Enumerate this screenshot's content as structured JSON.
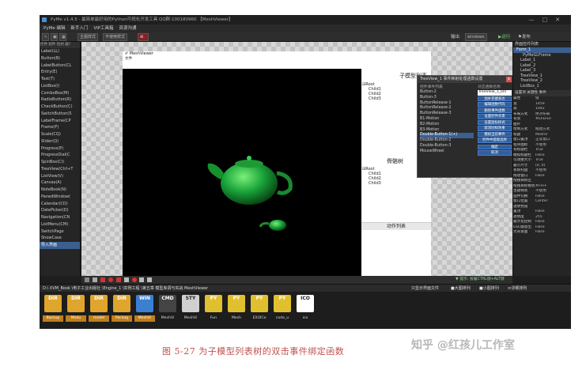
{
  "app": {
    "title": "PyMe v1.4.5 - 最简单最好用的Python可视化开发工具 QQ群:100180960 【MeshViewer】"
  },
  "menu": [
    "PyMe 编辑",
    "新手入门",
    "VIP工具箱",
    "资源沟通"
  ],
  "toolbar": {
    "btn1": "主题样式",
    "btn2": "不使用样式",
    "output": "输出",
    "platform": "windows",
    "run": "▶运行",
    "publish": "⚑发布"
  },
  "left_panel": {
    "tabs": "控件 组件 粒材 器?",
    "items": [
      "Label(LL)",
      "Button(B)",
      "LabelButton(CL",
      "Entry(E)",
      "Text(T)",
      "ListBox(I)",
      "ComboBox(M)",
      "RadioButton(R)",
      "CheckButton(C)",
      "SwitchButton(S",
      "LabelFrame(CP",
      "Frame(F)",
      "Scale(CQ)",
      "Slider(Q)",
      "Progress(P)",
      "ProgressDial(C",
      "SpinBox(CI)",
      "TreeView(Ctrl+T",
      "ListView(V)",
      "Canvas(A)",
      "NoteBook(N)",
      "PanedWindow(",
      "Calendar(CD)",
      "DatePicker(D)",
      "Navigation(CN",
      "ListMenu(CM)",
      "SwitchPage",
      "ShowCase",
      "导入界面"
    ]
  },
  "meshviewer": {
    "title": "MeshViewer",
    "menu": "文件",
    "right": {
      "header1": "子模型列表",
      "tree1": {
        "root": "Root",
        "children": [
          "Child1",
          "Child2",
          "Child3"
        ]
      },
      "header2": "骨骼树",
      "tree2": {
        "root": "Root",
        "children": [
          "Child1",
          "Child2",
          "Child3"
        ]
      },
      "header3": "动作列表"
    }
  },
  "dialog": {
    "title": "TreeView_1 事件映射处理函数设置",
    "close": "x",
    "col1_header": "控件事件列表",
    "col2_header": "对应函数名称",
    "events": [
      "Button-2",
      "Button-3",
      "ButtonRelease-1",
      "ButtonRelease-2",
      "ButtonRelease-3",
      "B1-Motion",
      "B2-Motion",
      "B3-Motion",
      "Double-Button-1(+)",
      "Double-Button-2",
      "Double-Button-3",
      "MouseWheel"
    ],
    "func_input": "TreeView_1_onl",
    "buttons": [
      "加补充键表达",
      "编辑函数代码",
      "删除事件函数",
      "设置控件背景",
      "设置鼠标样式",
      "取消同样效果",
      "模拟当前事件",
      "控件中提取选择"
    ],
    "ok": "确定",
    "cancel": "取消"
  },
  "right_panel": {
    "title": "界面控件列表",
    "tree": [
      {
        "label": "Form_1",
        "sel": true
      },
      {
        "label": "PyMeGLFrame",
        "sel": false
      },
      {
        "label": "Label_1",
        "sel": false
      },
      {
        "label": "Label_2",
        "sel": false
      },
      {
        "label": "Label_3",
        "sel": false
      },
      {
        "label": "TreeView_1",
        "sel": false
      },
      {
        "label": "TreeView_2",
        "sel": false
      },
      {
        "label": "ListBox_1",
        "sel": false
      }
    ],
    "prop_tabs": "设置项 关键性 事件",
    "props": [
      [
        "属性",
        "值"
      ],
      [
        "宽",
        "1459"
      ],
      [
        "高",
        "1042"
      ],
      [
        "布局方式",
        "绝对布局"
      ],
      [
        "背景",
        "#EFEFEF"
      ],
      [
        "图片",
        ""
      ],
      [
        "绘制方式",
        "缩放方式"
      ],
      [
        "标题",
        "MeshV"
      ],
      [
        "窗口置顶",
        "正常窗口"
      ],
      [
        "程序图标",
        "不使用"
      ],
      [
        "有标题栏",
        "True"
      ],
      [
        "模拟标题栏",
        "False"
      ],
      [
        "可调整大小",
        "True"
      ],
      [
        "最小尺寸",
        "(0, 0)"
      ],
      [
        "系统托盘",
        "不使用"
      ],
      [
        "拖动窗口",
        "False"
      ],
      [
        "拖拽目标区",
        ""
      ],
      [
        "拖拽目标模式",
        "#FFFF"
      ],
      [
        "主题样式",
        "不使用"
      ],
      [
        "固件切换",
        "False"
      ],
      [
        "窗口位置",
        "Center"
      ],
      [
        "透明色值",
        ""
      ],
      [
        "置顶",
        "False"
      ],
      [
        "透明度",
        "255"
      ],
      [
        "最大化控制",
        "False"
      ],
      [
        "ESC键退出",
        "False"
      ],
      [
        "大背景图",
        "False"
      ]
    ]
  },
  "status_hint": "▼ 提示: 按着CTRL键+ALT键+B，可对级别进行操作",
  "path": {
    "text": "D:\\ XVM_Book \\电子工业出版社 \\Engine_1 \\实例工程 \\第五章 模型库调与实战 MeshViewer",
    "right1": "只显示界面文件",
    "right2": "■大图排列",
    "right3": "■小图排列",
    "right4": "≡详细排列"
  },
  "file_icons": [
    {
      "glyph": "DIR",
      "label": "Backup",
      "color": "#e0a52c"
    },
    {
      "glyph": "DIR",
      "label": "Modu",
      "color": "#e0a52c"
    },
    {
      "glyph": "DIR",
      "label": "model",
      "color": "#e0a52c"
    },
    {
      "glyph": "DIR",
      "label": "Packag",
      "color": "#e0a52c"
    },
    {
      "glyph": "WIN",
      "label": "MeshVi",
      "color": "#3a7fd0"
    },
    {
      "glyph": "CMD",
      "label": "MeshVi",
      "color": "#444444"
    },
    {
      "glyph": "STY",
      "label": "MeshVi",
      "color": "#d0d0d0"
    },
    {
      "glyph": "PY",
      "label": "Fun",
      "color": "#e0c030"
    },
    {
      "glyph": "PY",
      "label": "Mesh",
      "color": "#e0c030"
    },
    {
      "glyph": "PY",
      "label": "EXUICo",
      "color": "#e0c030"
    },
    {
      "glyph": "PY",
      "label": "code_u",
      "color": "#e0c030"
    },
    {
      "glyph": "ICO",
      "label": "ico",
      "color": "#ffffff"
    }
  ],
  "caption": "图 5-27   为子模型列表树的双击事件绑定函数",
  "watermark": "知乎 @红孩儿工作室"
}
